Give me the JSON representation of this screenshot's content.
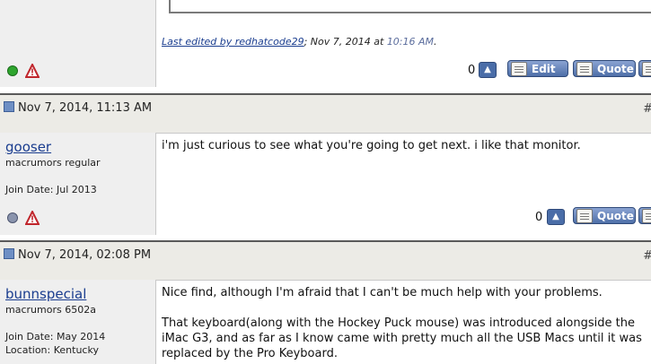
{
  "post1": {
    "edit_note": {
      "prefix": "Last edited by redhatcode29",
      "date": "; Nov 7, 2014 at",
      "time": "10:16 AM",
      "suffix": "."
    },
    "like_count": "0",
    "edit_label": "Edit",
    "quote_label": "Quote"
  },
  "post2": {
    "date": "Nov 7, 2014, 11:13 AM",
    "username": "gooser",
    "rank": "macrumors regular",
    "join_date": "Join Date: Jul 2013",
    "message": "i'm just curious to see what you're going to get next. i like that monitor.",
    "like_count": "0",
    "quote_label": "Quote",
    "post_number": "#"
  },
  "post3": {
    "date": "Nov 7, 2014, 02:08 PM",
    "username": "bunnspecial",
    "rank": "macrumors 6502a",
    "join_date": "Join Date: May 2014",
    "location": "Location: Kentucky",
    "message_line1": "Nice find, although I'm afraid that I can't be much help with your problems.",
    "message_para2": "That keyboard(along with the Hockey Puck mouse) was introduced alongside the iMac G3, and as far as I know came with pretty much all the USB Macs until it was replaced by the Pro Keyboard.",
    "post_number": "#"
  },
  "colors": {
    "header_bg": "#ecebe6",
    "sidebar_bg": "#efefef",
    "link": "#1a3d8f",
    "button": "#4e6fa8",
    "online": "#2ea52e"
  }
}
